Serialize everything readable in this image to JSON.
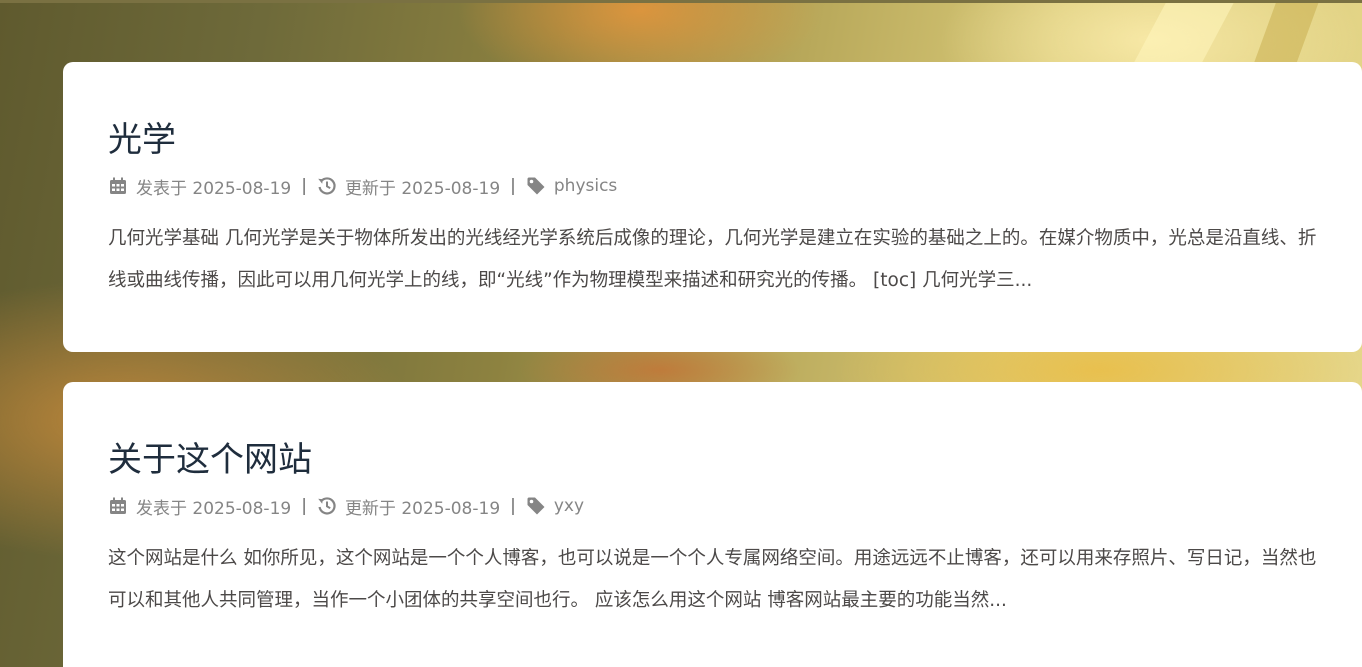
{
  "colors": {
    "title": "#1f2d3d",
    "meta": "#858585",
    "excerpt": "#4c4948",
    "card_background": "#ffffff"
  },
  "posts": [
    {
      "title": "光学",
      "published_label": "发表于 2025-08-19",
      "updated_label": "更新于 2025-08-19",
      "separator": "|",
      "tag": "physics",
      "excerpt": "几何光学基础 几何光学是关于物体所发出的光线经光学系统后成像的理论，几何光学是建立在实验的基础之上的。在媒介物质中，光总是沿直线、折线或曲线传播，因此可以用几何光学上的线，即“光线”作为物理模型来描述和研究光的传播。 [toc] 几何光学三..."
    },
    {
      "title": "关于这个网站",
      "published_label": "发表于 2025-08-19",
      "updated_label": "更新于 2025-08-19",
      "separator": "|",
      "tag": "yxy",
      "excerpt": "这个网站是什么 如你所见，这个网站是一个个人博客，也可以说是一个个人专属网络空间。用途远远不止博客，还可以用来存照片、写日记，当然也可以和其他人共同管理，当作一个小团体的共享空间也行。 应该怎么用这个网站 博客网站最主要的功能当然..."
    }
  ],
  "icons": {
    "published": "calendar-icon",
    "updated": "history-icon",
    "tag": "tag-icon"
  }
}
